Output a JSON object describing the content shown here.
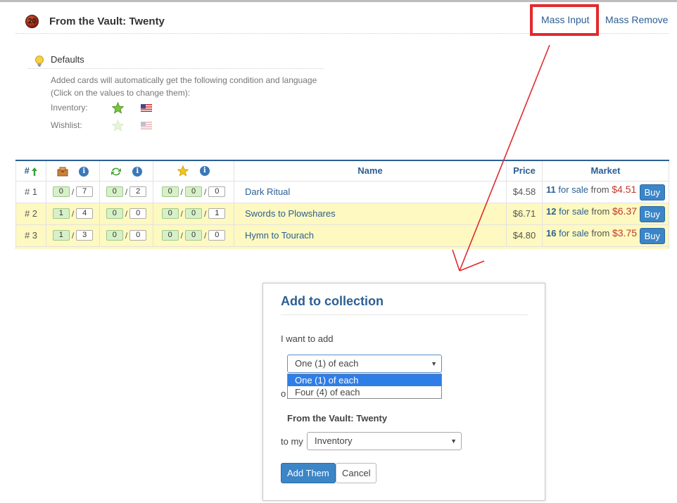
{
  "header": {
    "set_badge": "20",
    "set_title": "From the Vault: Twenty",
    "mass_input": "Mass Input",
    "mass_remove": "Mass Remove"
  },
  "defaults": {
    "title": "Defaults",
    "desc_line1": "Added cards will automatically get the following condition and language",
    "desc_line2": "(Click on the values to change them):",
    "inventory_label": "Inventory:",
    "wishlist_label": "Wishlist:",
    "icons": {
      "bulb": "lightbulb-icon",
      "condition": "star-icon",
      "language": "us-flag-icon"
    }
  },
  "table": {
    "headers": {
      "number": "#",
      "name": "Name",
      "price": "Price",
      "market": "Market"
    },
    "header_icons": [
      "sort-up-arrow-icon",
      "collection-box-icon",
      "trade-arrows-icon",
      "wishlist-star-icon",
      "info-icon"
    ],
    "rows": [
      {
        "num": "# 1",
        "inv": [
          "0",
          "7"
        ],
        "trade": [
          "0",
          "2"
        ],
        "wish": [
          "0",
          "0",
          "0"
        ],
        "name": "Dark Ritual",
        "price": "$4.58",
        "for_sale_count": "11",
        "for_sale_text": "for sale",
        "from": "from",
        "low_price": "$4.51",
        "buy": "Buy"
      },
      {
        "num": "# 2",
        "inv": [
          "1",
          "4"
        ],
        "trade": [
          "0",
          "0"
        ],
        "wish": [
          "0",
          "0",
          "1"
        ],
        "name": "Swords to Plowshares",
        "price": "$6.71",
        "for_sale_count": "12",
        "for_sale_text": "for sale",
        "from": "from",
        "low_price": "$6.37",
        "buy": "Buy"
      },
      {
        "num": "# 3",
        "inv": [
          "1",
          "3"
        ],
        "trade": [
          "0",
          "0"
        ],
        "wish": [
          "0",
          "0",
          "0"
        ],
        "name": "Hymn to Tourach",
        "price": "$4.80",
        "for_sale_count": "16",
        "for_sale_text": "for sale",
        "from": "from",
        "low_price": "$3.75",
        "buy": "Buy"
      }
    ]
  },
  "dialog": {
    "title": "Add to collection",
    "want_label": "I want to add",
    "qty_selected": "One (1) of each",
    "qty_options": [
      "One (1) of each",
      "Four (4) of each"
    ],
    "or_label": "o",
    "set_name": "From the Vault: Twenty",
    "to_my_label": "to my",
    "destination_selected": "Inventory",
    "add_button": "Add Them",
    "cancel_button": "Cancel"
  },
  "colors": {
    "accent_blue": "#2b5f94",
    "button_blue": "#3c85c6",
    "highlight_red": "#e02a2e",
    "row_yellow": "#fdf9c0",
    "price_red": "#c0392b"
  }
}
